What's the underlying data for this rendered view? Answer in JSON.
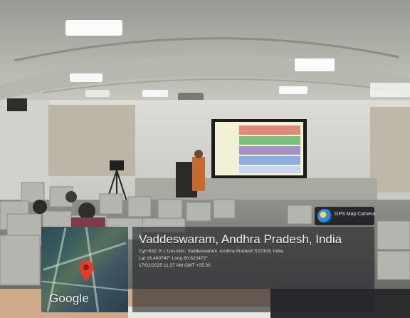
{
  "photo": {
    "description_icon": "photo-icon"
  },
  "map": {
    "google_label": "Google",
    "pin_color": "#e23b2e"
  },
  "gps_badge": {
    "label": "GPS Map Camera"
  },
  "location": {
    "title": "Vaddeswaram, Andhra Pradesh, India",
    "address": "Cyt+632, K L Uni-Attic, Vaddeswaram, Andhra Pradesh 522303, India",
    "coords": "Lat 16.460747° Long 80.622472°",
    "datetime": "17/01/2025 11:37 AM GMT +05:30"
  }
}
